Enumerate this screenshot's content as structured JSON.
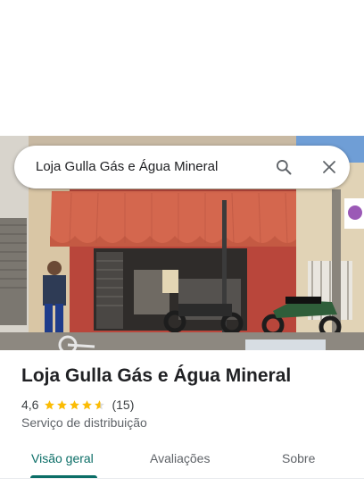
{
  "search": {
    "query": "Loja Gulla Gás e Água Mineral"
  },
  "place": {
    "name": "Loja Gulla Gás e Água Mineral",
    "rating": "4,6",
    "rating_value": 4.6,
    "review_count": "(15)",
    "category": "Serviço de distribuição"
  },
  "tabs": [
    {
      "label": "Visão geral",
      "active": true
    },
    {
      "label": "Avaliações",
      "active": false
    },
    {
      "label": "Sobre",
      "active": false
    }
  ],
  "icons": {
    "search": "search-icon",
    "close": "close-icon",
    "star": "star-icon"
  },
  "colors": {
    "accent": "#0b6e67",
    "star": "#fbbc04",
    "awning": "#d4674e"
  }
}
